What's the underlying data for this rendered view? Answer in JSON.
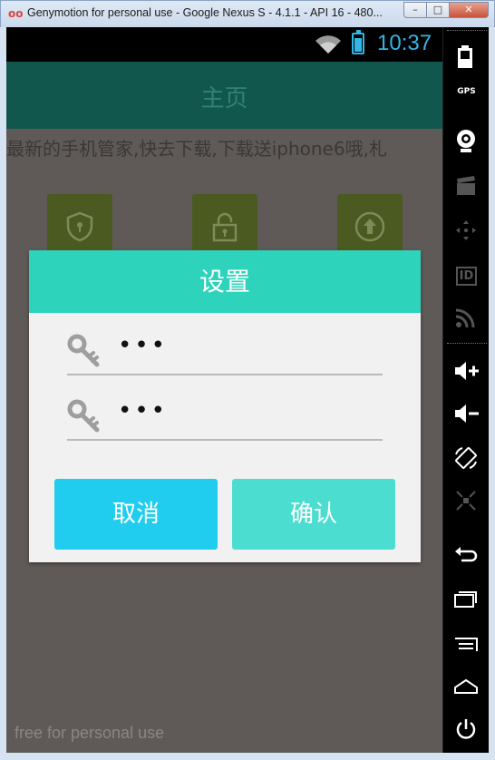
{
  "window": {
    "title": "Genymotion for personal use - Google Nexus S - 4.1.1 - API 16 - 480...",
    "minimize_label": "–",
    "maximize_label": "□",
    "close_label": "✕"
  },
  "statusbar": {
    "time": "10:37"
  },
  "app": {
    "title": "主页",
    "marquee": "最新的手机管家,快去下载,下载送iphone6哦,札",
    "tiles": [
      {
        "icon": "shield-icon"
      },
      {
        "icon": "lock-icon"
      },
      {
        "icon": "upload-icon"
      }
    ]
  },
  "dialog": {
    "title": "设置",
    "password_value": "•••",
    "confirm_password_value": "•••",
    "cancel_label": "取消",
    "ok_label": "确认",
    "header_color": "#2ed3bb",
    "cancel_color": "#21cdef",
    "ok_color": "#4bded0"
  },
  "watermark": "free for personal use",
  "side_panel": {
    "items": [
      "battery-icon",
      "gps-icon",
      "camera-icon",
      "clapper-icon",
      "dpad-icon",
      "id-icon",
      "rss-icon",
      "volume-up-icon",
      "volume-down-icon",
      "rotate-icon",
      "scale-icon",
      "back-icon",
      "recent-apps-icon",
      "menu-icon",
      "home-icon",
      "power-icon"
    ],
    "gps_label": "GPS",
    "id_label": "ID"
  }
}
